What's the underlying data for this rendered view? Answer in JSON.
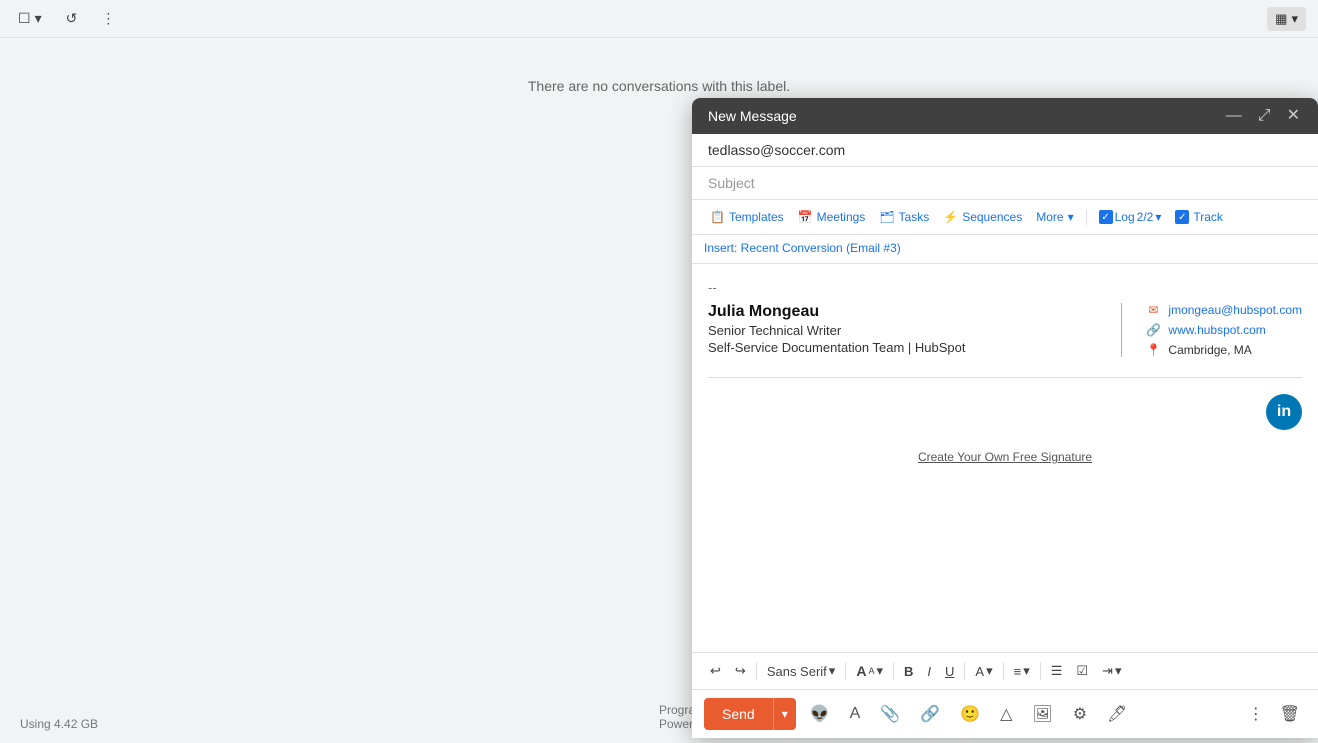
{
  "toolbar": {
    "checkbox_label": "",
    "refresh_label": "↺",
    "more_label": "⋮",
    "grid_label": "▦",
    "grid_dropdown": "▾"
  },
  "main": {
    "empty_state": "There are no conversations with this label."
  },
  "footer": {
    "storage": "Using 4.42 GB",
    "program_policy": "Program Polic",
    "powered_by": "Powered by Go"
  },
  "compose": {
    "title": "New Message",
    "to_value": "tedlasso@soccer.com",
    "subject_placeholder": "Subject",
    "toolbar": {
      "templates_label": "Templates",
      "meetings_label": "Meetings",
      "tasks_label": "Tasks",
      "sequences_label": "Sequences",
      "more_label": "More",
      "log_label": "Log",
      "log_count": "2/2",
      "track_label": "Track"
    },
    "insert_row": {
      "label": "Insert: Recent Conversion (Email #3)"
    },
    "signature": {
      "separator": "--",
      "name": "Julia Mongeau",
      "title": "Senior Technical Writer",
      "company": "Self-Service Documentation Team | HubSpot",
      "email": "jmongeau@hubspot.com",
      "website": "www.hubspot.com",
      "location": "Cambridge, MA"
    },
    "create_sig": "Create Your Own Free Signature",
    "format_toolbar": {
      "undo": "↩",
      "redo": "↪",
      "font_family": "Sans Serif",
      "font_size": "A",
      "bold": "B",
      "italic": "I",
      "underline": "U",
      "font_color": "A",
      "align": "≡",
      "bullets": "☰",
      "checklist": "☑",
      "indent": "⇥"
    },
    "send_toolbar": {
      "send_label": "Send",
      "send_dropdown": "▾"
    }
  }
}
